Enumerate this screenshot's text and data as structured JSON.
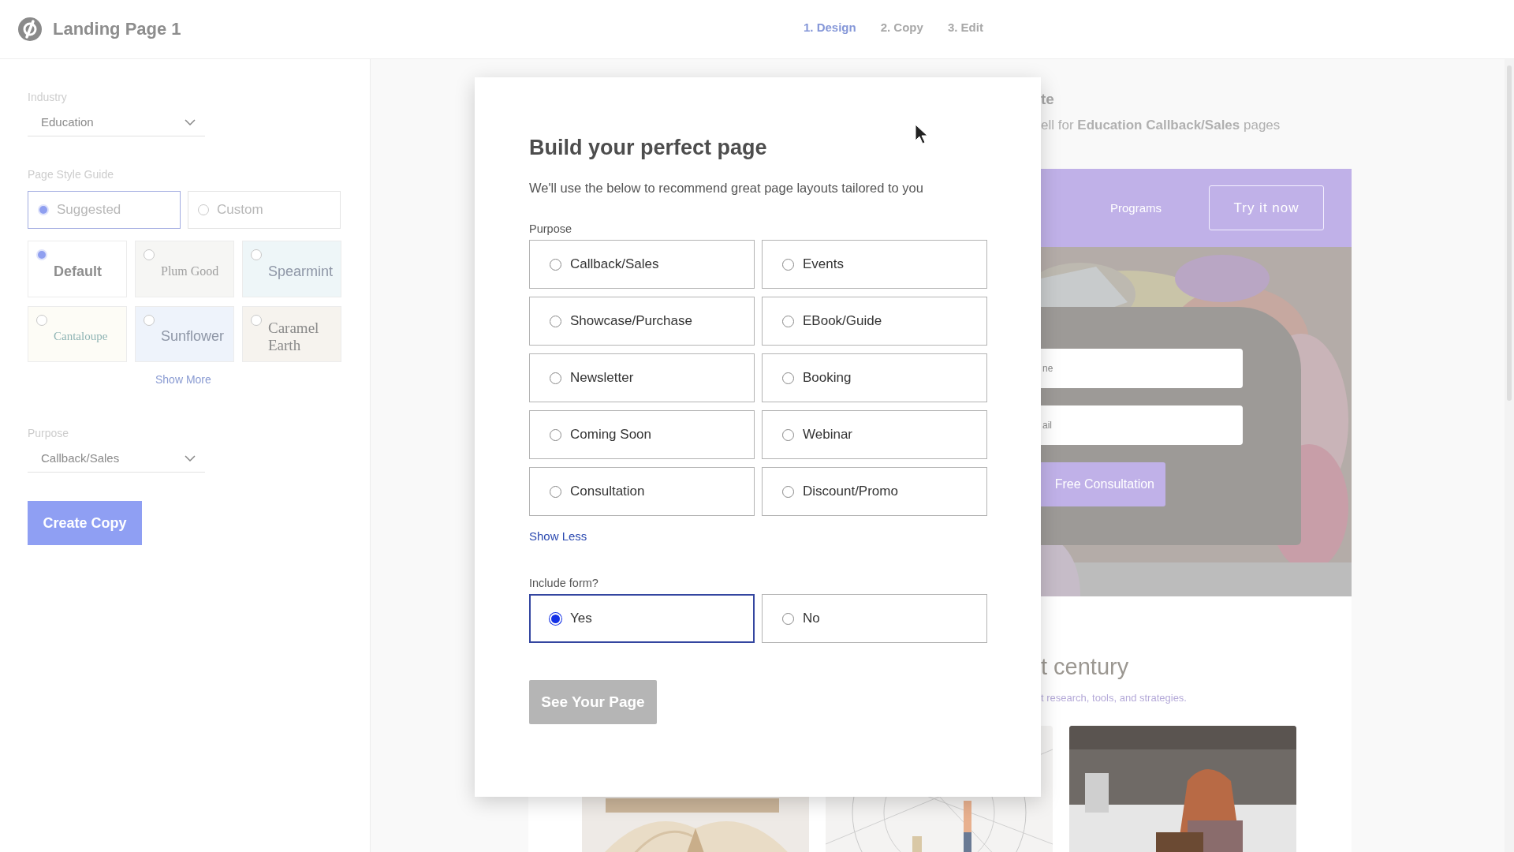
{
  "app": {
    "title": "Landing Page 1"
  },
  "steps": [
    {
      "label": "1. Design",
      "selected": true
    },
    {
      "label": "2. Copy",
      "selected": false
    },
    {
      "label": "3. Edit",
      "selected": false
    }
  ],
  "sidebar": {
    "industry": {
      "label": "Industry",
      "value": "Education"
    },
    "style_guide": {
      "label": "Page Style Guide",
      "modes": [
        {
          "label": "Suggested",
          "selected": true
        },
        {
          "label": "Custom",
          "selected": false
        }
      ],
      "themes": [
        {
          "label": "Default",
          "selected": true,
          "kind": "bold",
          "color": "#ffffff"
        },
        {
          "label": "Plum Good",
          "selected": false,
          "kind": "serif",
          "color": "#f6f6f4"
        },
        {
          "label": "Spearmint",
          "selected": false,
          "kind": "sans",
          "color": "#eef6f8"
        },
        {
          "label": "Cantaloupe",
          "selected": false,
          "kind": "serif",
          "color": "#fdfcf6"
        },
        {
          "label": "Sunflower",
          "selected": false,
          "kind": "sans",
          "color": "#eef3fb"
        },
        {
          "label": "Caramel Earth",
          "selected": false,
          "kind": "serif",
          "color": "#f6f3ee"
        }
      ],
      "show_more": "Show More"
    },
    "purpose": {
      "label": "Purpose",
      "value": "Callback/Sales"
    },
    "create_button": "Create Copy"
  },
  "modal": {
    "title": "Build your perfect page",
    "subtitle": "We'll use the below to recommend great page layouts tailored to you",
    "purpose": {
      "label": "Purpose",
      "options": [
        {
          "label": "Callback/Sales",
          "selected": false
        },
        {
          "label": "Events",
          "selected": false
        },
        {
          "label": "Showcase/Purchase",
          "selected": false
        },
        {
          "label": "EBook/Guide",
          "selected": false
        },
        {
          "label": "Newsletter",
          "selected": false
        },
        {
          "label": "Booking",
          "selected": false
        },
        {
          "label": "Coming Soon",
          "selected": false
        },
        {
          "label": "Webinar",
          "selected": false
        },
        {
          "label": "Consultation",
          "selected": false
        },
        {
          "label": "Discount/Promo",
          "selected": false
        }
      ]
    },
    "show_less": "Show Less",
    "include_form": {
      "label": "Include form?",
      "options": [
        {
          "label": "Yes",
          "selected": true
        },
        {
          "label": "No",
          "selected": false
        }
      ]
    },
    "submit": {
      "label": "See Your Page",
      "disabled": true
    }
  },
  "preview": {
    "heading": "te",
    "subtitle": "ell for **Education Callback/Sales** pages",
    "nav_link": "Programs",
    "cta": "Try it now",
    "fields": [
      {
        "placeholder": "ne"
      },
      {
        "placeholder": "ail"
      }
    ],
    "form_button": "Free Consultation",
    "section_heading": "t century",
    "section_subtitle": "t research, tools, and strategies."
  }
}
